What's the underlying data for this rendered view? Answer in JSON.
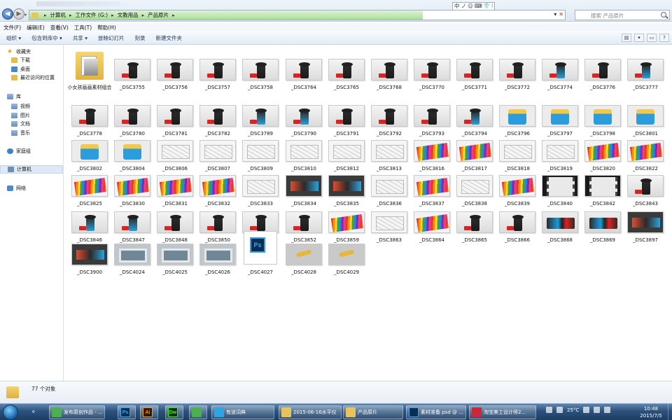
{
  "window": {
    "address_path": [
      "计算机",
      "工作文件 (G:)",
      "文教用品",
      "产品原片"
    ],
    "search_placeholder": "搜索 产品原片",
    "ime_items": [
      "中",
      "ノ",
      "☺",
      "⌨",
      "👕",
      "⁝"
    ]
  },
  "menu": [
    "文件(F)",
    "编辑(E)",
    "查看(V)",
    "工具(T)",
    "帮助(H)"
  ],
  "toolbar": [
    "组织 ▾",
    "包含到库中 ▾",
    "共享 ▾",
    "放映幻灯片",
    "刻录",
    "新建文件夹"
  ],
  "sidebar": [
    {
      "label": "收藏夹",
      "icon": "star-icon"
    },
    {
      "label": "下载",
      "icon": "download-folder-icon"
    },
    {
      "label": "桌面",
      "icon": "desktop-icon"
    },
    {
      "label": "最近访问的位置",
      "icon": "recent-places-icon"
    },
    {
      "label": "库",
      "icon": "library-icon"
    },
    {
      "label": "视频",
      "icon": "videos-icon"
    },
    {
      "label": "图片",
      "icon": "pictures-icon"
    },
    {
      "label": "文档",
      "icon": "documents-icon"
    },
    {
      "label": "音乐",
      "icon": "music-icon"
    },
    {
      "label": "家庭组",
      "icon": "homegroup-icon"
    },
    {
      "label": "计算机",
      "icon": "computer-icon"
    },
    {
      "label": "网络",
      "icon": "network-icon"
    }
  ],
  "files": [
    {
      "name": "小女孩画画素材组合",
      "type": "folder"
    },
    {
      "name": "_DSC3755",
      "type": "product"
    },
    {
      "name": "_DSC3756",
      "type": "product"
    },
    {
      "name": "_DSC3757",
      "type": "product"
    },
    {
      "name": "_DSC3758",
      "type": "product"
    },
    {
      "name": "_DSC3764",
      "type": "product"
    },
    {
      "name": "_DSC3765",
      "type": "product"
    },
    {
      "name": "_DSC3768",
      "type": "product"
    },
    {
      "name": "_DSC3770",
      "type": "product"
    },
    {
      "name": "_DSC3771",
      "type": "product"
    },
    {
      "name": "_DSC3772",
      "type": "product"
    },
    {
      "name": "_DSC3774",
      "type": "blue"
    },
    {
      "name": "_DSC3776",
      "type": "product"
    },
    {
      "name": "_DSC3777",
      "type": "blue"
    },
    {
      "name": "_DSC3778",
      "type": "product"
    },
    {
      "name": "_DSC3780",
      "type": "product"
    },
    {
      "name": "_DSC3781",
      "type": "product"
    },
    {
      "name": "_DSC3782",
      "type": "product"
    },
    {
      "name": "_DSC3789",
      "type": "blue"
    },
    {
      "name": "_DSC3790",
      "type": "blue"
    },
    {
      "name": "_DSC3791",
      "type": "product"
    },
    {
      "name": "_DSC3792",
      "type": "product"
    },
    {
      "name": "_DSC3793",
      "type": "product"
    },
    {
      "name": "_DSC3794",
      "type": "blue"
    },
    {
      "name": "_DSC3796",
      "type": "cup"
    },
    {
      "name": "_DSC3797",
      "type": "cup"
    },
    {
      "name": "_DSC3798",
      "type": "cup"
    },
    {
      "name": "_DSC3801",
      "type": "cup"
    },
    {
      "name": "_DSC3802",
      "type": "cup"
    },
    {
      "name": "_DSC3804",
      "type": "cup"
    },
    {
      "name": "_DSC3806",
      "type": "sketch"
    },
    {
      "name": "_DSC3807",
      "type": "sketch"
    },
    {
      "name": "_DSC3809",
      "type": "sketch"
    },
    {
      "name": "_DSC3810",
      "type": "sketch"
    },
    {
      "name": "_DSC3812",
      "type": "sketch"
    },
    {
      "name": "_DSC3813",
      "type": "sketch"
    },
    {
      "name": "_DSC3816",
      "type": "pens"
    },
    {
      "name": "_DSC3817",
      "type": "pens"
    },
    {
      "name": "_DSC3818",
      "type": "sketch"
    },
    {
      "name": "_DSC3819",
      "type": "sketch"
    },
    {
      "name": "_DSC3820",
      "type": "pens"
    },
    {
      "name": "_DSC3822",
      "type": "pens"
    },
    {
      "name": "_DSC3825",
      "type": "pens"
    },
    {
      "name": "_DSC3830",
      "type": "pens"
    },
    {
      "name": "_DSC3831",
      "type": "pens"
    },
    {
      "name": "_DSC3832",
      "type": "pens"
    },
    {
      "name": "_DSC3833",
      "type": "sketch"
    },
    {
      "name": "_DSC3834",
      "type": "dark"
    },
    {
      "name": "_DSC3835",
      "type": "dark"
    },
    {
      "name": "_DSC3836",
      "type": "sketch"
    },
    {
      "name": "_DSC3837",
      "type": "pens"
    },
    {
      "name": "_DSC3838",
      "type": "sketch"
    },
    {
      "name": "_DSC3839",
      "type": "pens"
    },
    {
      "name": "_DSC3840",
      "type": "film"
    },
    {
      "name": "_DSC3842",
      "type": "film"
    },
    {
      "name": "_DSC3843",
      "type": "product"
    },
    {
      "name": "_DSC3846",
      "type": "blue"
    },
    {
      "name": "_DSC3847",
      "type": "blue"
    },
    {
      "name": "_DSC3848",
      "type": "product"
    },
    {
      "name": "_DSC3850",
      "type": "product"
    },
    {
      "name": "_DSC3851",
      "type": "product"
    },
    {
      "name": "_DSC3852",
      "type": "product"
    },
    {
      "name": "_DSC3859",
      "type": "pens"
    },
    {
      "name": "_DSC3863",
      "type": "sketch"
    },
    {
      "name": "_DSC3864",
      "type": "pens"
    },
    {
      "name": "_DSC3865",
      "type": "product"
    },
    {
      "name": "_DSC3866",
      "type": "product"
    },
    {
      "name": "_DSC3868",
      "type": "wide"
    },
    {
      "name": "_DSC3869",
      "type": "wide"
    },
    {
      "name": "_DSC3897",
      "type": "dark"
    },
    {
      "name": "_DSC3900",
      "type": "dark"
    },
    {
      "name": "_DSC4024",
      "type": "window"
    },
    {
      "name": "_DSC4025",
      "type": "window"
    },
    {
      "name": "_DSC4026",
      "type": "window"
    },
    {
      "name": "_DSC4027",
      "type": "psd"
    },
    {
      "name": "_DSC4028",
      "type": "hand"
    },
    {
      "name": "_DSC4029",
      "type": "hand"
    }
  ],
  "status": {
    "count_text": "77 个对象"
  },
  "taskbar": {
    "apps": [
      {
        "label": "",
        "icon": "ie-icon",
        "kind": "ie"
      },
      {
        "label": "发布原创作品 - ...",
        "icon": "browser-icon",
        "kind": "green"
      },
      {
        "label": "Ps",
        "icon": "photoshop-icon",
        "kind": "ps"
      },
      {
        "label": "Ai",
        "icon": "illustrator-icon",
        "kind": "ai"
      },
      {
        "label": "Dw",
        "icon": "dreamweaver-icon",
        "kind": "dw"
      },
      {
        "label": "",
        "icon": "chat-icon",
        "kind": "green"
      },
      {
        "label": "有道词典",
        "icon": "youdao-icon",
        "kind": "yd"
      },
      {
        "label": "2015-06-16水平仪",
        "icon": "folder-icon",
        "kind": "fold"
      },
      {
        "label": "产品原片",
        "icon": "folder-icon",
        "kind": "fold"
      },
      {
        "label": "素材准备.psd @ ...",
        "icon": "photoshop-icon",
        "kind": "ps"
      },
      {
        "label": "淘宝美工设计师2...",
        "icon": "red-app-icon",
        "kind": "red"
      }
    ],
    "tray_text": [
      "25°C"
    ],
    "clock": {
      "time": "10:48",
      "date": "2015/7/5"
    }
  }
}
